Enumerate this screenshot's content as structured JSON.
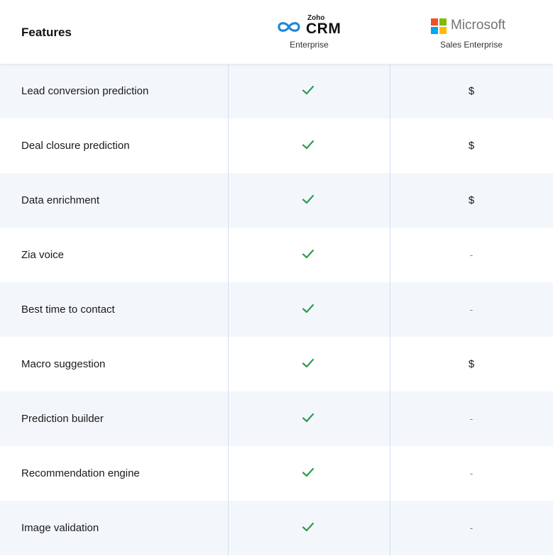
{
  "header": {
    "features_label": "Features",
    "zoho": {
      "brand_top": "Zoho",
      "brand_main": "CRM",
      "edition": "Enterprise"
    },
    "microsoft": {
      "brand": "Microsoft",
      "edition": "Sales Enterprise"
    }
  },
  "rows": [
    {
      "feature": "Lead conversion prediction",
      "zoho_icon": "check-icon",
      "microsoft": "$"
    },
    {
      "feature": "Deal closure prediction",
      "zoho_icon": "check-icon",
      "microsoft": "$"
    },
    {
      "feature": "Data enrichment",
      "zoho_icon": "check-icon",
      "microsoft": "$"
    },
    {
      "feature": "Zia voice",
      "zoho_icon": "check-icon",
      "microsoft": "-"
    },
    {
      "feature": "Best time to contact",
      "zoho_icon": "check-icon",
      "microsoft": "-"
    },
    {
      "feature": "Macro suggestion",
      "zoho_icon": "check-icon",
      "microsoft": "$"
    },
    {
      "feature": "Prediction builder",
      "zoho_icon": "check-icon",
      "microsoft": "-"
    },
    {
      "feature": "Recommendation engine",
      "zoho_icon": "check-icon",
      "microsoft": "-"
    },
    {
      "feature": "Image validation",
      "zoho_icon": "check-icon",
      "microsoft": "-"
    }
  ],
  "colors": {
    "check_green": "#2e9c4e",
    "alt_row_bg": "#f3f7fc",
    "column_divider": "#cfe0f2",
    "zoho_logo_blue": "#1e88d8",
    "ms_red": "#f25022",
    "ms_green": "#7fba00",
    "ms_blue": "#00a4ef",
    "ms_yellow": "#ffb900"
  }
}
